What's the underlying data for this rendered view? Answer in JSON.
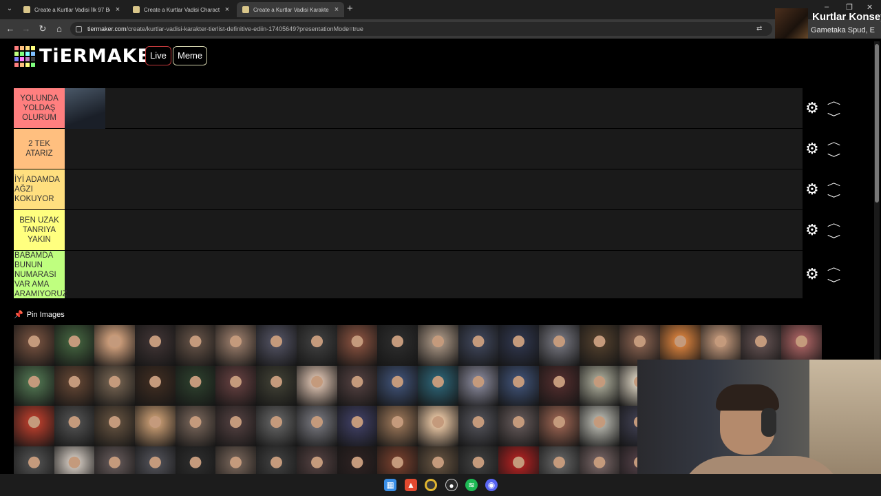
{
  "browser": {
    "tabs": [
      {
        "title": "Create a Kurtlar Vadisi İlk 97 Bö…",
        "active": false
      },
      {
        "title": "Create a Kurtlar Vadisi Characte",
        "active": false
      },
      {
        "title": "Create a Kurtlar Vadisi Karakter",
        "active": true
      }
    ],
    "new_tab_label": "+",
    "url_host": "tiermaker.com",
    "url_path": "/create/kurtlar-vadisi-karakter-tierlist-definitive-ediin-17405649?presentationMode=true"
  },
  "music": {
    "title": "Kurtlar Konsey",
    "subtitle": "Gametaka Spud, E"
  },
  "site": {
    "logo_text": "TiERMAKER",
    "live_label": "Live",
    "meme_label": "Meme",
    "logo_colors": [
      "#ff7f7f",
      "#ffbf7f",
      "#ffdf7f",
      "#ffff7f",
      "#bfff7f",
      "#7fff7f",
      "#7fffff",
      "#7fbfff",
      "#7f7fff",
      "#ff7fff",
      "#bf7fbf",
      "#3f3f3f",
      "#ff7f7f",
      "#ffbf7f",
      "#ffff7f",
      "#7fff7f"
    ]
  },
  "tiers": [
    {
      "label": "YOLUNDA YOLDAŞ OLURUM",
      "color": "#ff7f7f",
      "items": [
        {
          "color": "#4a5868"
        }
      ]
    },
    {
      "label": "2 TEK ATARIZ",
      "color": "#ffbf7f",
      "items": []
    },
    {
      "label": "İYİ ADAMDA AĞZI KOKUYOR",
      "color": "#ffdf7f",
      "items": []
    },
    {
      "label": "BEN UZAK TANRIYA YAKIN",
      "color": "#ffff7f",
      "items": []
    },
    {
      "label": "BABAMDA BUNUN NUMARASI VAR AMA ARAMIYORUZ",
      "color": "#bfff7f",
      "items": []
    }
  ],
  "pin_images_label": "Pin Images",
  "pool_colors": [
    "#6a4a3a",
    "#3e5a3a",
    "#c89a78",
    "#3a3030",
    "#5a4a40",
    "#8a7060",
    "#4a4a58",
    "#3a3a3a",
    "#7a4a3a",
    "#2a2a2a",
    "#9a8878",
    "#3a4052",
    "#2c3246",
    "#6a6a72",
    "#4a3a2a",
    "#7a5848",
    "#c8783a",
    "#b08a70",
    "#5a4a4a",
    "#9a5a5a",
    "#4a6a4a",
    "#5a4030",
    "#6a5a4a",
    "#3a2a20",
    "#2a3a2a",
    "#5a3a3a",
    "#3a3a30",
    "#c8b0a0",
    "#4a3a3a",
    "#3a4a6a",
    "#2a5a6a",
    "#7a7a8a",
    "#3a4a6a",
    "#4a2a2a",
    "#9a9a8a",
    "#c8c0b0",
    "#2a2a2a",
    "#3a3030",
    "#3a4050",
    "#6a5040",
    "#aa3a2a",
    "#4a4a4a",
    "#5a4a3a",
    "#b8906a",
    "#6a5a50",
    "#4a3a3a",
    "#5a5a5a",
    "#6a6a70",
    "#3a3a5a",
    "#8a6a50",
    "#d8b898",
    "#4a4a50",
    "#5a5050",
    "#8a5a4a",
    "#a8a8a0",
    "#3a3a4a",
    "#2a2a2a",
    "#5a4a40",
    "#b0a090",
    "#4a4a4a",
    "#4a4a4a",
    "#c0b8b0",
    "#5a5050",
    "#4a4a50",
    "#2a2a2a",
    "#6a5a50",
    "#3a3a3a",
    "#4a3a3a",
    "#2a2020",
    "#6a3a2a",
    "#5a4a3a",
    "#3a3a3a",
    "#a02020",
    "#5a5a5a",
    "#6a5a5a",
    "#4a3a40",
    "#8a6a50",
    "#5a4a40",
    "#3a3a3a",
    "#4a4a4a"
  ],
  "taskbar_icons": [
    "windows-start",
    "brave",
    "chrome",
    "obs",
    "spotify",
    "discord"
  ]
}
